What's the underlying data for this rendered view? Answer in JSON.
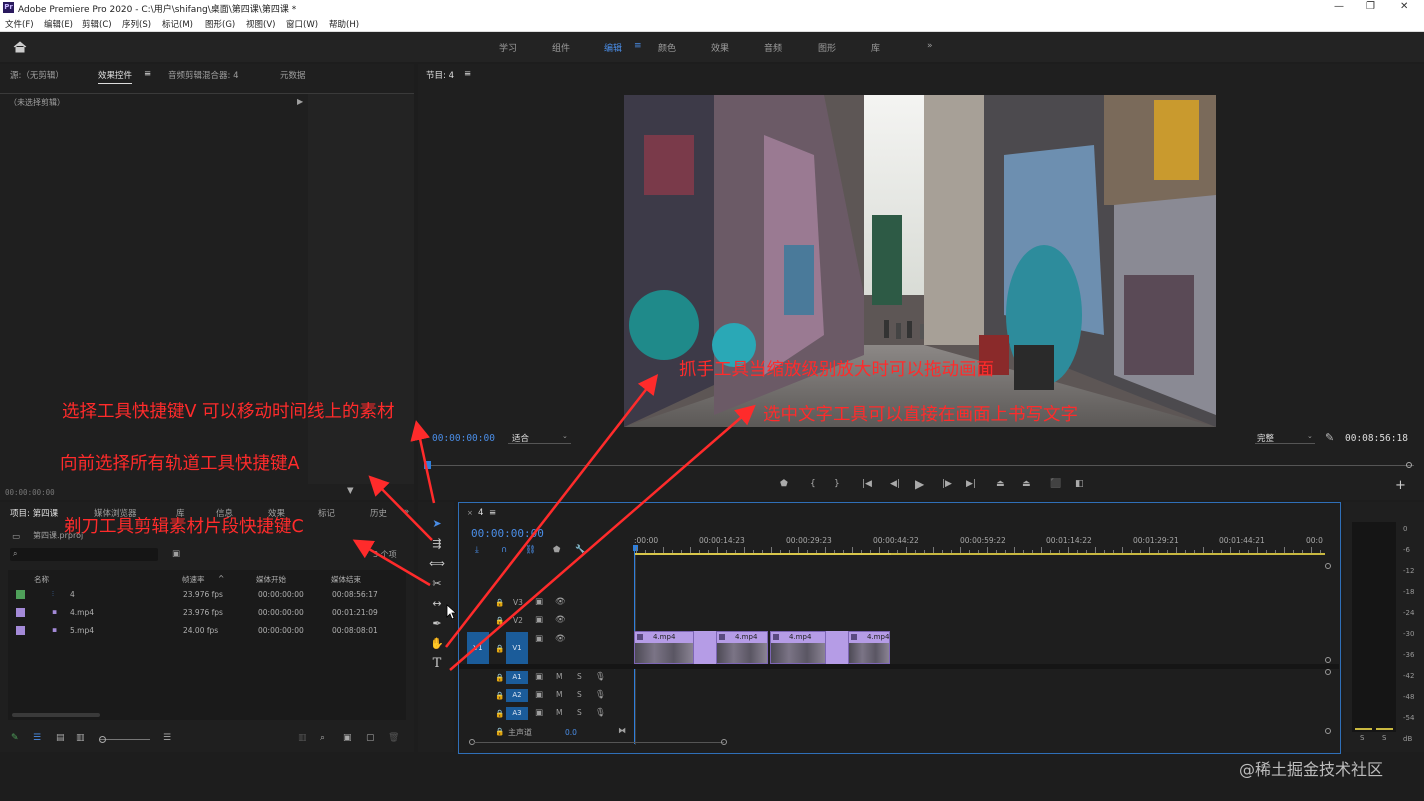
{
  "titlebar": {
    "title": "Adobe Premiere Pro 2020 - C:\\用户\\shifang\\桌面\\第四课\\第四课 *",
    "logo": "Pr",
    "min": "—",
    "max": "❐",
    "close": "✕"
  },
  "menu": [
    "文件(F)",
    "编辑(E)",
    "剪辑(C)",
    "序列(S)",
    "标记(M)",
    "图形(G)",
    "视图(V)",
    "窗口(W)",
    "帮助(H)"
  ],
  "workspaces": [
    "学习",
    "组件",
    "编辑",
    "颜色",
    "效果",
    "音频",
    "图形",
    "库",
    "»"
  ],
  "source_panel": {
    "tabs": [
      "源:（无剪辑）",
      "效果控件",
      "音频剪辑混合器: 4",
      "元数据"
    ],
    "no_clip": "（未选择剪辑）",
    "timecode": "00:00:00:00"
  },
  "program": {
    "label": "节目: 4",
    "timecode": "00:00:00:00",
    "fit": "适合",
    "quality": "完整",
    "duration": "00:08:56:18"
  },
  "project": {
    "tabs": [
      "项目: 第四课",
      "媒体浏览器",
      "库",
      "信息",
      "效果",
      "标记",
      "历史"
    ],
    "file": "第四课.prproj",
    "count": "3 个项",
    "cols": [
      "名称",
      "帧速率",
      "媒体开始",
      "媒体结束"
    ],
    "rows": [
      {
        "name": "4",
        "fps": "23.976 fps",
        "start": "00:00:00:00",
        "end": "00:08:56:17",
        "color": "#4fa05a"
      },
      {
        "name": "4.mp4",
        "fps": "23.976 fps",
        "start": "00:00:00:00",
        "end": "00:01:21:09",
        "color": "#a48ad8"
      },
      {
        "name": "5.mp4",
        "fps": "24.00 fps",
        "start": "00:00:00:00",
        "end": "00:08:08:01",
        "color": "#a48ad8"
      }
    ]
  },
  "timeline": {
    "tab": "4",
    "timecode": "00:00:00:00",
    "ruler": [
      ":00:00",
      "00:00:14:23",
      "00:00:29:23",
      "00:00:44:22",
      "00:00:59:22",
      "00:01:14:22",
      "00:01:29:21",
      "00:01:44:21",
      "00:0"
    ],
    "tracks_video": [
      "V3",
      "V2",
      "V1"
    ],
    "source_patch": "V1",
    "tracks_audio": [
      "A1",
      "A2",
      "A3"
    ],
    "master": "主声道",
    "master_val": "0.0",
    "clips": [
      "4.mp4",
      "4.mp4",
      "4.mp4",
      "4.mp4"
    ]
  },
  "meter": {
    "labels": [
      "0",
      "-6",
      "-12",
      "-18",
      "-24",
      "-30",
      "-36",
      "-42",
      "-48",
      "-54",
      "dB"
    ],
    "solo": [
      "S",
      "S"
    ]
  },
  "annotations": {
    "hand": "抓手工具当缩放级别放大时可以拖动画面",
    "text": "选中文字工具可以直接在画面上书写文字",
    "select": "选择工具快捷键V 可以移动时间线上的素材",
    "track": "向前选择所有轨道工具快捷键A",
    "razor": "剃刀工具剪辑素材片段快捷键C"
  },
  "watermark": "@稀土掘金技术社区",
  "colors": {
    "accent": "#4a8de6",
    "annotation": "#ff2b2b",
    "clip": "#b59ce6",
    "playhead": "#2f7fdc"
  }
}
